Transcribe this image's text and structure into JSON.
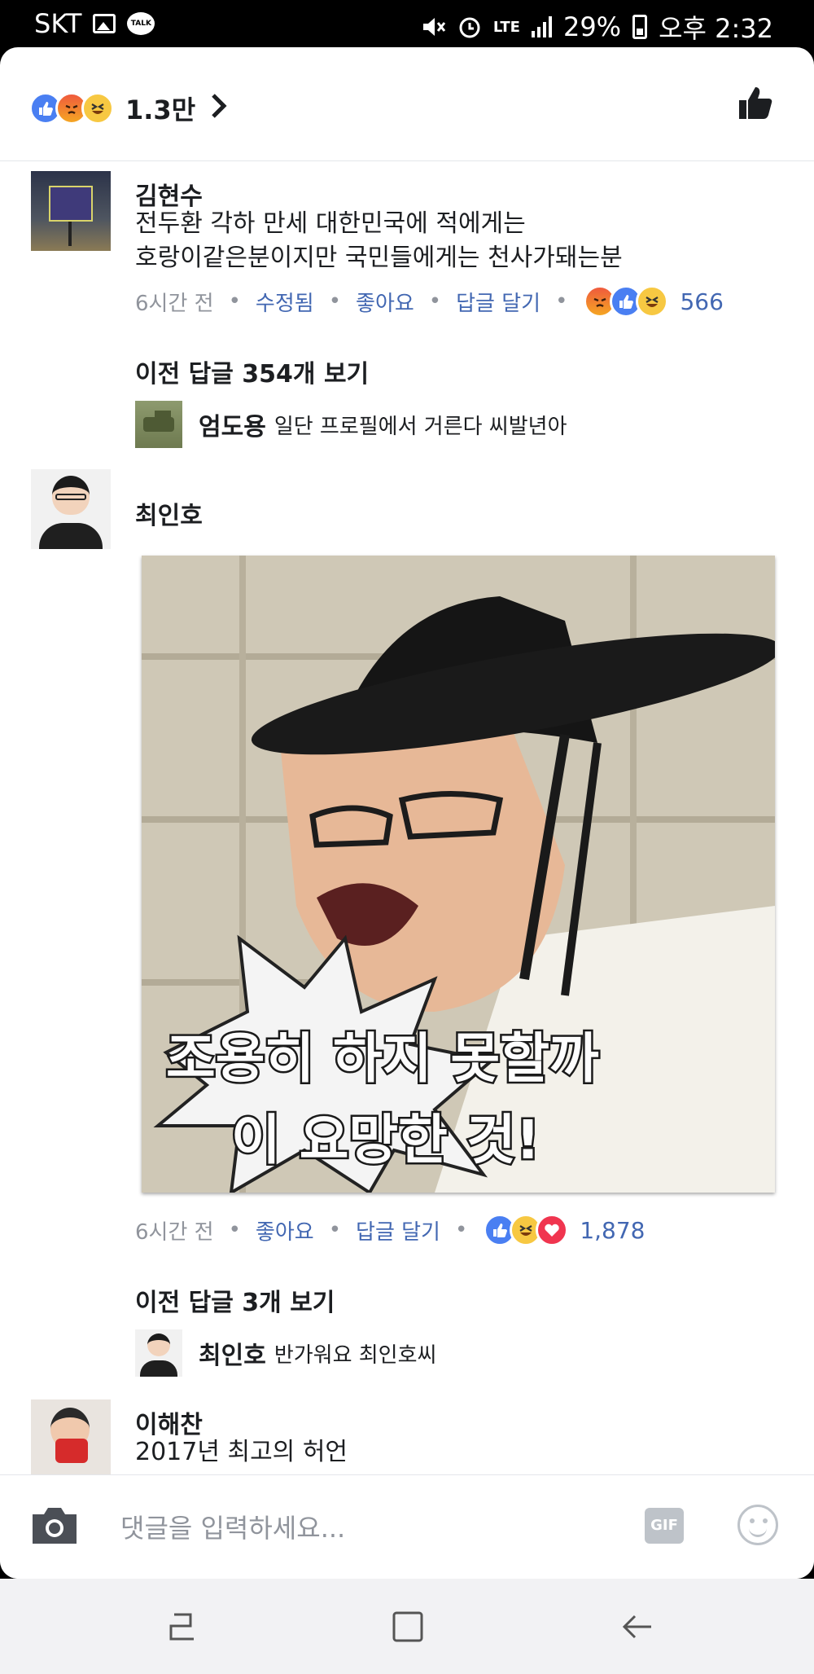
{
  "status_bar": {
    "carrier": "SKT",
    "talk_badge": "TALK",
    "network": "LTE",
    "battery": "29%",
    "time": "오후 2:32"
  },
  "header": {
    "reaction_count": "1.3만",
    "reactions": [
      "like-icon",
      "angry-icon",
      "haha-icon"
    ]
  },
  "comments": [
    {
      "name": "김현수",
      "text_line1": "전두환 각하 만세 대한민국에 적에게는",
      "text_line2": "호랑이같은분이지만 국민들에게는 천사가돼는분",
      "time": "6시간 전",
      "edited": "수정됨",
      "like": "좋아요",
      "reply": "답글 달기",
      "reaction_count": "566",
      "view_previous": "이전 답글 354개 보기",
      "reply_preview": {
        "name": "엄도용",
        "text": "일단 프로필에서 거른다 씨발년아"
      }
    },
    {
      "name": "최인호",
      "meme_caption_line1": "조용히 하지 못할까",
      "meme_caption_line2": "이 요망한 것!",
      "time": "6시간 전",
      "like": "좋아요",
      "reply": "답글 달기",
      "reaction_count": "1,878",
      "view_previous": "이전 답글 3개 보기",
      "reply_preview": {
        "name": "최인호",
        "text": "반가워요 최인호씨"
      }
    },
    {
      "name": "이해찬",
      "text": "2017년 최고의 허언"
    }
  ],
  "composer": {
    "placeholder": "댓글을 입력하세요...",
    "gif_label": "GIF"
  },
  "colors": {
    "link_blue": "#4267b2",
    "like_blue": "#4a7ff2",
    "meta_gray": "#90949c"
  }
}
